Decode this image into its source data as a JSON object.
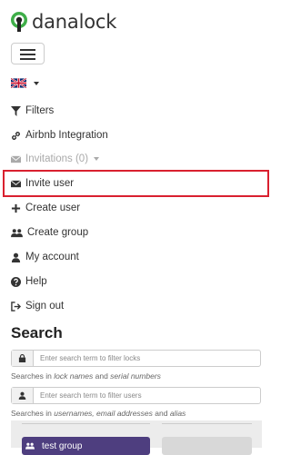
{
  "brand": {
    "name": "danalock",
    "logo_color": "#3fae49"
  },
  "nav": {
    "language_flag": "uk-flag-icon",
    "items": [
      {
        "icon": "filter-icon",
        "label": "Filters"
      },
      {
        "icon": "link-icon",
        "label": "Airbnb Integration"
      },
      {
        "icon": "envelope-icon",
        "label": "Invitations (0)"
      },
      {
        "icon": "envelope-icon",
        "label": "Invite user"
      },
      {
        "icon": "plus-icon",
        "label": "Create user"
      },
      {
        "icon": "users-icon",
        "label": "Create group"
      },
      {
        "icon": "user-icon",
        "label": "My account"
      },
      {
        "icon": "question-circle-icon",
        "label": "Help"
      },
      {
        "icon": "sign-out-icon",
        "label": "Sign out"
      }
    ]
  },
  "search": {
    "title": "Search",
    "locks_placeholder": "Enter search term to filter locks",
    "locks_help_prefix": "Searches in ",
    "locks_help_em1": "lock names",
    "locks_help_mid": " and ",
    "locks_help_em2": "serial numbers",
    "users_placeholder": "Enter search term to filter users",
    "users_help_prefix": "Searches in ",
    "users_help_em1": "usernames, email addresses",
    "users_help_mid": " and ",
    "users_help_em2": "alias"
  },
  "groups": {
    "button_label": "test group",
    "button_color": "#4e3e7f"
  },
  "highlight_color": "#d9202f"
}
